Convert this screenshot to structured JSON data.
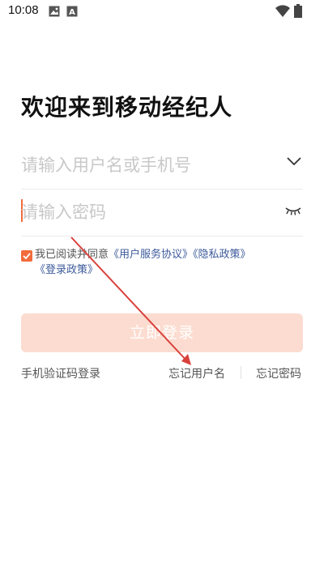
{
  "status_bar": {
    "time": "10:08",
    "icons": [
      "image-icon",
      "a-icon",
      "wifi-icon",
      "battery-icon"
    ]
  },
  "title": "欢迎来到移动经纪人",
  "username_field": {
    "placeholder": "请输入用户名或手机号",
    "icon": "chevron-down-icon"
  },
  "password_field": {
    "placeholder": "请输入密码",
    "icon": "eye-closed-icon"
  },
  "agreement": {
    "prefix": "我已阅读并同意",
    "link_terms": "《用户服务协议》",
    "link_privacy": "《隐私政策》",
    "link_login_policy": "《登录政策》",
    "checked": true
  },
  "login_button": "立即登录",
  "links": {
    "sms_login": "手机验证码登录",
    "forgot_username": "忘记用户名",
    "forgot_password": "忘记密码"
  },
  "colors": {
    "accent": "#f26b3a",
    "button_disabled": "#fcdcd0",
    "link": "#3c5a9a",
    "annotation": "#d9403a"
  }
}
